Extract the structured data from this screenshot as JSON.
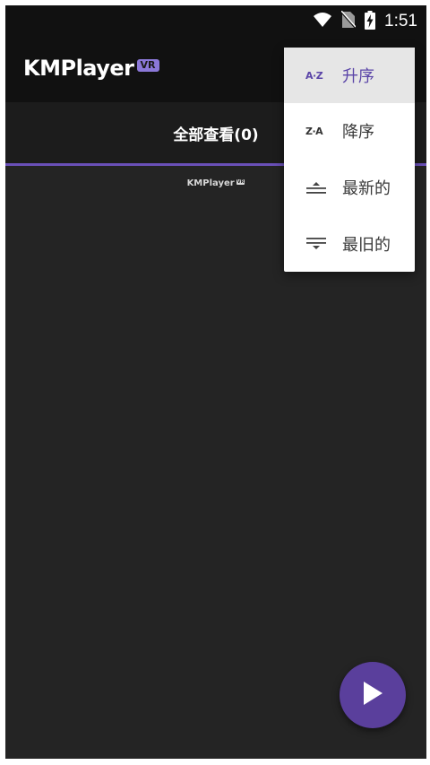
{
  "status_bar": {
    "time": "1:51",
    "icons": [
      "wifi-icon",
      "no-sim-icon",
      "battery-charging-icon"
    ]
  },
  "app_bar": {
    "logo_text": "KMPlayer",
    "logo_badge": "VR"
  },
  "tabs": [
    {
      "label": "全部查看(0)",
      "selected": true
    }
  ],
  "content": {
    "watermark_text": "KMPlayer",
    "watermark_badge": "VR"
  },
  "sort_menu": {
    "items": [
      {
        "icon_text": "A·Z",
        "icon": "sort-az-icon",
        "label": "升序",
        "selected": true
      },
      {
        "icon_text": "Z·A",
        "icon": "sort-za-icon",
        "label": "降序",
        "selected": false
      },
      {
        "icon": "sort-newest-icon",
        "label": "最新的",
        "selected": false
      },
      {
        "icon": "sort-oldest-icon",
        "label": "最旧的",
        "selected": false
      }
    ]
  },
  "fab": {
    "icon": "play-icon"
  },
  "colors": {
    "accent": "#5a3f9c",
    "tab_indicator": "#6a50b8",
    "badge": "#8b78d8",
    "background": "#242424",
    "app_bar": "#111111"
  }
}
